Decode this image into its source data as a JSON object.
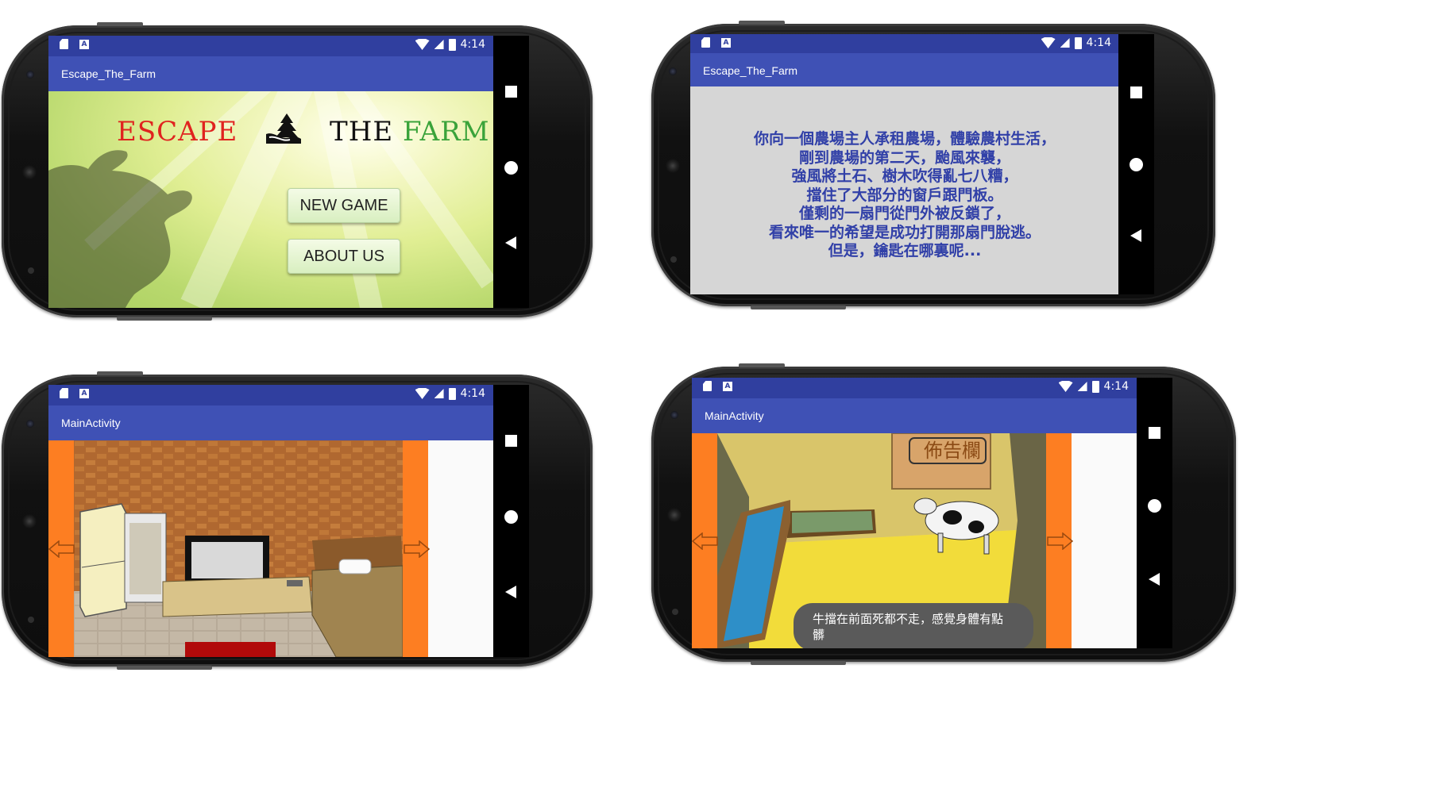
{
  "status": {
    "time": "4:14"
  },
  "phones": [
    {
      "title": "Escape_The_Farm"
    },
    {
      "title": "Escape_The_Farm"
    },
    {
      "title": "MainActivity"
    },
    {
      "title": "MainActivity"
    }
  ],
  "menu": {
    "logo_word1": "ESCAPE",
    "logo_word2": "THE",
    "logo_word3": "FARM",
    "new_game": "NEW GAME",
    "about_us": "ABOUT US"
  },
  "about": {
    "lines": [
      "你向一個農場主人承租農場，體驗農村生活，",
      "剛到農場的第二天，颱風來襲，",
      "強風將土石、樹木吹得亂七八糟，",
      "擋住了大部分的窗戶跟門板。",
      "僅剩的一扇門從門外被反鎖了，",
      "看來唯一的希望是成功打開那扇門脫逃。",
      "但是，鑰匙在哪裏呢..."
    ]
  },
  "barn": {
    "sign": "佈告欄",
    "toast": "牛擋在前面死都不走，感覺身體有點髒"
  },
  "colors": {
    "status_bar": "#303f9f",
    "app_bar": "#3f51b5",
    "orange": "#fd7e22",
    "about_text": "#3140a8"
  }
}
